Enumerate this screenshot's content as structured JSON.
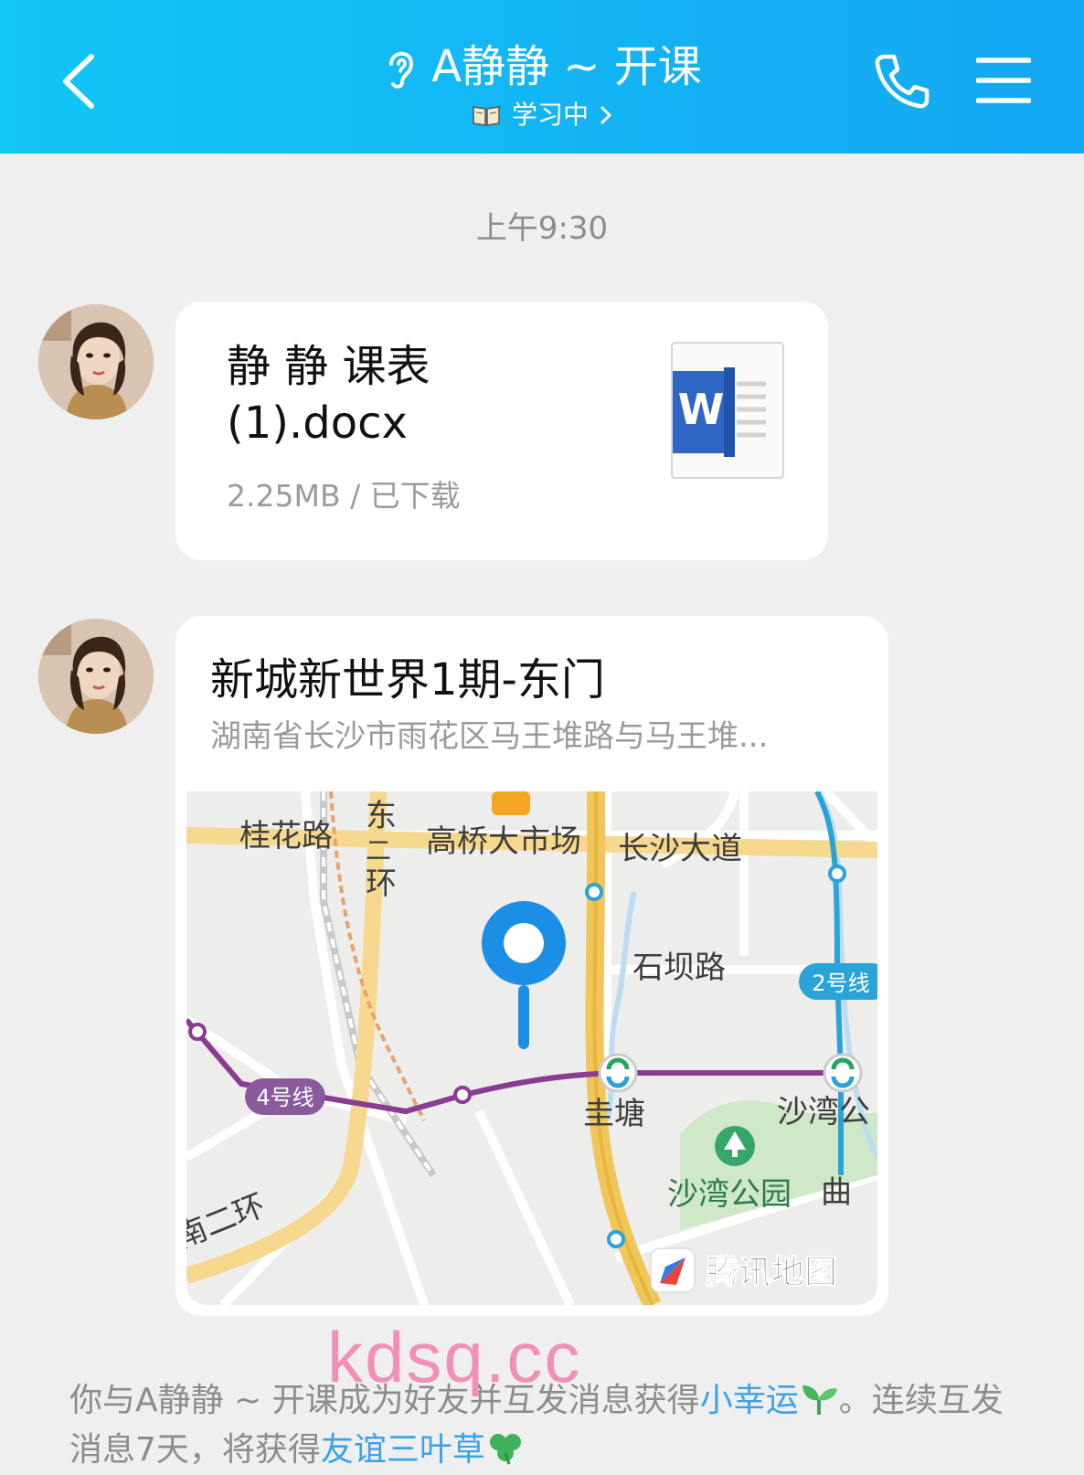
{
  "header": {
    "title": "A静静 ~ 开课",
    "status": "学习中",
    "title_icon": "ear-icon",
    "status_icon": "book-icon",
    "gradient": [
      "#12c6f6",
      "#14a7f2"
    ]
  },
  "timestamp": "上午9:30",
  "messages": [
    {
      "type": "file",
      "file_name": "静 静 课表 (1).docx",
      "file_meta": "2.25MB / 已下载",
      "file_icon": "word-doc-icon",
      "icon_letter": "W"
    },
    {
      "type": "location",
      "place_name": "新城新世界1期-东门",
      "address": "湖南省长沙市雨花区马王堆路与马王堆...",
      "map": {
        "labels": {
          "guihua_road": "桂花路",
          "dong": "东",
          "er": "二",
          "huan": "环",
          "gaoqiao_market": "高桥大市场",
          "changsha_avenue": "长沙大道",
          "shiba_road": "石坝路",
          "line2": "2号线",
          "line4": "4号线",
          "guitang": "圭塘",
          "shawan": "沙湾公",
          "shawan_park": "沙湾公园",
          "qu": "曲",
          "south_ring": "南二环",
          "brand": "腾讯地图"
        }
      }
    }
  ],
  "watermark": "kdsq.cc",
  "notice": {
    "part1": "你与A静静 ~ 开课成为好友并互发消息获得",
    "highlight1": "小幸运",
    "part2": "。连续互发消息7天，将获得",
    "highlight2": "友谊三叶草"
  }
}
